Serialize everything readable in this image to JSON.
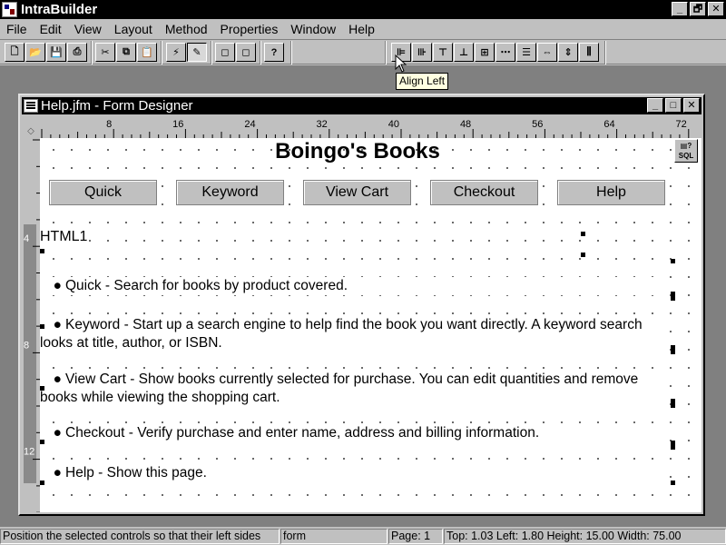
{
  "app": {
    "title": "IntraBuilder",
    "caption_buttons": [
      "_",
      "🗗",
      "✕"
    ]
  },
  "menubar": {
    "items": [
      "File",
      "Edit",
      "View",
      "Layout",
      "Method",
      "Properties",
      "Window",
      "Help"
    ]
  },
  "toolbar": {
    "buttons": [
      {
        "icon": "new-file-icon",
        "glyph": "🗋"
      },
      {
        "icon": "open-folder-icon",
        "glyph": "📂"
      },
      {
        "icon": "save-icon",
        "glyph": "💾"
      },
      {
        "icon": "print-icon",
        "glyph": "⎙"
      },
      {
        "icon": "cut-icon",
        "glyph": "✂"
      },
      {
        "icon": "copy-icon",
        "glyph": "⧉"
      },
      {
        "icon": "paste-icon",
        "glyph": "📋"
      },
      {
        "icon": "run-icon",
        "glyph": "⚡"
      },
      {
        "icon": "design-icon",
        "glyph": "✎"
      },
      {
        "icon": "page-back-icon",
        "glyph": "◻"
      },
      {
        "icon": "page-forward-icon",
        "glyph": "◻"
      },
      {
        "icon": "help-icon",
        "glyph": "?"
      },
      {
        "icon": "align-left-icon",
        "glyph": "⊫"
      },
      {
        "icon": "align-right-icon",
        "glyph": "⊪"
      },
      {
        "icon": "align-top-icon",
        "glyph": "⊤"
      },
      {
        "icon": "align-bottom-icon",
        "glyph": "⊥"
      },
      {
        "icon": "align-vcenter-icon",
        "glyph": "⊞"
      },
      {
        "icon": "space-horizontal-icon",
        "glyph": "⋯"
      },
      {
        "icon": "align-hcenter-icon",
        "glyph": "☰"
      },
      {
        "icon": "same-width-icon",
        "glyph": "⇔"
      },
      {
        "icon": "same-height-icon",
        "glyph": "⇕"
      },
      {
        "icon": "distribute-icon",
        "glyph": "⫼"
      }
    ],
    "tooltip": "Align Left"
  },
  "designer": {
    "title": "Help.jfm - Form Designer",
    "caption_buttons": [
      "_",
      "□",
      "✕"
    ],
    "ruler_top": [
      "8",
      "16",
      "24",
      "32",
      "40",
      "48",
      "56",
      "64",
      "72"
    ],
    "ruler_left": [
      "4",
      "8",
      "12"
    ],
    "ruler_corner": "◇",
    "form": {
      "heading": "Boingo's Books",
      "sql_icon_label": "SQL",
      "nav_buttons": [
        "Quick",
        "Keyword",
        "View Cart",
        "Checkout",
        "Help"
      ],
      "html_label": "HTML1",
      "items": [
        {
          "bullet": "●",
          "text": "Quick - Search for books by product covered."
        },
        {
          "bullet": "●",
          "text": "Keyword - Start up a search engine to help find the book you want directly. A keyword search looks at title, author, or ISBN."
        },
        {
          "bullet": "●",
          "text": "View Cart - Show books currently selected for purchase. You can edit quantities and remove books while viewing the shopping cart."
        },
        {
          "bullet": "●",
          "text": "Checkout - Verify purchase and enter name, address and billing information."
        },
        {
          "bullet": "●",
          "text": "Help - Show this page."
        }
      ]
    }
  },
  "statusbar": {
    "message": "Position the selected controls so that their left sides",
    "object": "form",
    "page": "Page: 1",
    "metrics": "Top: 1.03 Left: 1.80 Height: 15.00 Width: 75.00"
  }
}
